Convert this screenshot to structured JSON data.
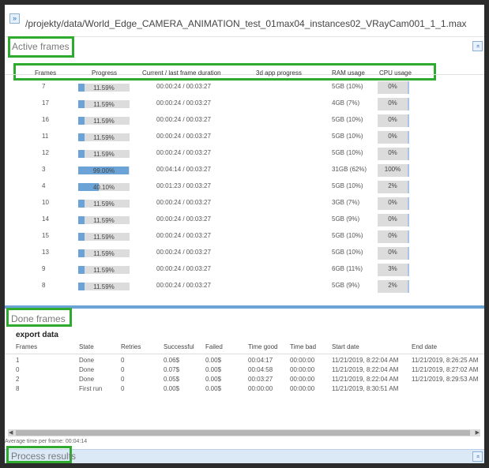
{
  "header": {
    "expand_icon": "»",
    "path": "/projekty/data/World_Edge_CAMERA_ANIMATION_test_01max04_instances02_VRayCam001_1_1.max"
  },
  "active": {
    "title": "Active frames",
    "collapse_icon": "«",
    "columns": [
      "Frames",
      "Progress",
      "Current / last frame duration",
      "3d app progress",
      "RAM usage",
      "CPU usage"
    ],
    "rows": [
      {
        "frame": "7",
        "progress": 11.59,
        "progress_label": "11.59%",
        "duration": "00:00:24 / 00:03:27",
        "ram": "5GB (10%)",
        "cpu": "0%"
      },
      {
        "frame": "17",
        "progress": 11.59,
        "progress_label": "11.59%",
        "duration": "00:00:24 / 00:03:27",
        "ram": "4GB (7%)",
        "cpu": "0%"
      },
      {
        "frame": "16",
        "progress": 11.59,
        "progress_label": "11.59%",
        "duration": "00:00:24 / 00:03:27",
        "ram": "5GB (10%)",
        "cpu": "0%"
      },
      {
        "frame": "11",
        "progress": 11.59,
        "progress_label": "11.59%",
        "duration": "00:00:24 / 00:03:27",
        "ram": "5GB (10%)",
        "cpu": "0%"
      },
      {
        "frame": "12",
        "progress": 11.59,
        "progress_label": "11.59%",
        "duration": "00:00:24 / 00:03:27",
        "ram": "5GB (10%)",
        "cpu": "0%"
      },
      {
        "frame": "3",
        "progress": 99.0,
        "progress_label": "99.00%",
        "duration": "00:04:14 / 00:03:27",
        "ram": "31GB (62%)",
        "cpu": "100%"
      },
      {
        "frame": "4",
        "progress": 40.1,
        "progress_label": "40.10%",
        "duration": "00:01:23 / 00:03:27",
        "ram": "5GB (10%)",
        "cpu": "2%"
      },
      {
        "frame": "10",
        "progress": 11.59,
        "progress_label": "11.59%",
        "duration": "00:00:24 / 00:03:27",
        "ram": "3GB (7%)",
        "cpu": "0%"
      },
      {
        "frame": "14",
        "progress": 11.59,
        "progress_label": "11.59%",
        "duration": "00:00:24 / 00:03:27",
        "ram": "5GB (9%)",
        "cpu": "0%"
      },
      {
        "frame": "15",
        "progress": 11.59,
        "progress_label": "11.59%",
        "duration": "00:00:24 / 00:03:27",
        "ram": "5GB (10%)",
        "cpu": "0%"
      },
      {
        "frame": "13",
        "progress": 11.59,
        "progress_label": "11.59%",
        "duration": "00:00:24 / 00:03:27",
        "ram": "5GB (10%)",
        "cpu": "0%"
      },
      {
        "frame": "9",
        "progress": 11.59,
        "progress_label": "11.59%",
        "duration": "00:00:24 / 00:03:27",
        "ram": "6GB (11%)",
        "cpu": "3%"
      },
      {
        "frame": "8",
        "progress": 11.59,
        "progress_label": "11.59%",
        "duration": "00:00:24 / 00:03:27",
        "ram": "5GB (9%)",
        "cpu": "2%"
      }
    ]
  },
  "done": {
    "title": "Done frames",
    "export_title": "export data",
    "columns": [
      "Frames",
      "State",
      "Retries",
      "Successful",
      "Failed",
      "Time good",
      "Time bad",
      "Start date",
      "End date"
    ],
    "rows": [
      {
        "frames": "1",
        "state": "Done",
        "retries": "0",
        "successful": "0.06$",
        "failed": "0.00$",
        "time_good": "00:04:17",
        "time_bad": "00:00:00",
        "start": "11/21/2019, 8:22:04 AM",
        "end": "11/21/2019, 8:26:25 AM"
      },
      {
        "frames": "0",
        "state": "Done",
        "retries": "0",
        "successful": "0.07$",
        "failed": "0.00$",
        "time_good": "00:04:58",
        "time_bad": "00:00:00",
        "start": "11/21/2019, 8:22:04 AM",
        "end": "11/21/2019, 8:27:02 AM"
      },
      {
        "frames": "2",
        "state": "Done",
        "retries": "0",
        "successful": "0.05$",
        "failed": "0.00$",
        "time_good": "00:03:27",
        "time_bad": "00:00:00",
        "start": "11/21/2019, 8:22:04 AM",
        "end": "11/21/2019, 8:29:53 AM"
      },
      {
        "frames": "8",
        "state": "First run",
        "retries": "0",
        "successful": "0.00$",
        "failed": "0.00$",
        "time_good": "00:00:00",
        "time_bad": "00:00:00",
        "start": "11/21/2019, 8:30:51 AM",
        "end": ""
      }
    ],
    "avg_text": "Average time per frame: 00:04:14"
  },
  "process": {
    "title": "Process results",
    "collapse_icon": "«"
  },
  "colors": {
    "highlight": "#2eab2e",
    "accent": "#6ba3d6"
  }
}
